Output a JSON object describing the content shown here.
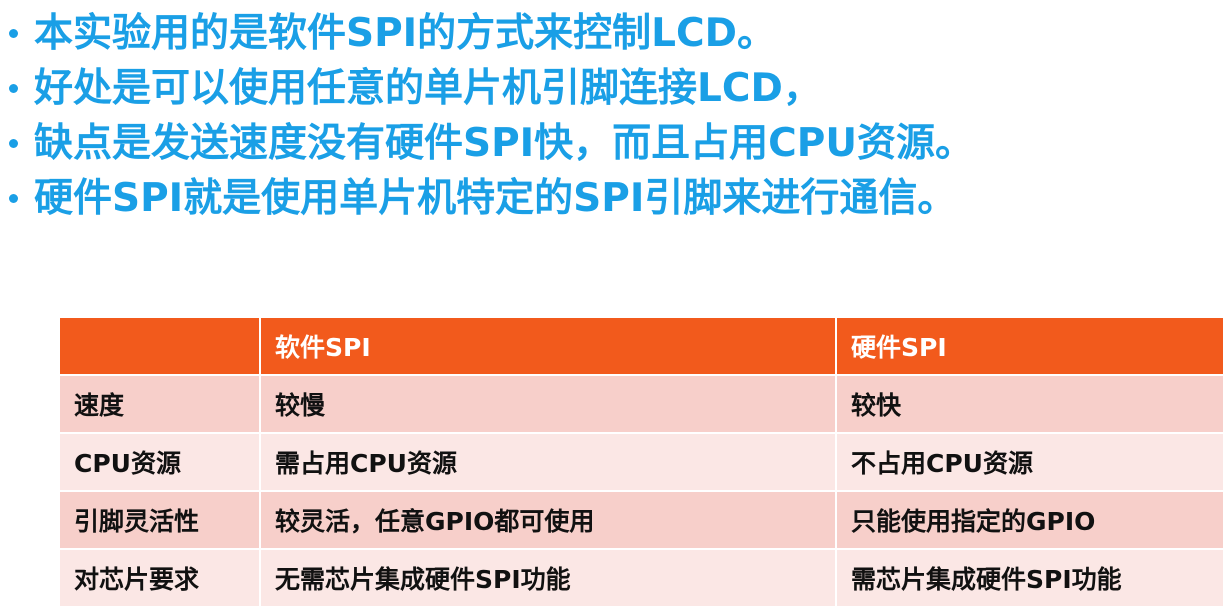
{
  "colors": {
    "bullet_text": "#1a9fe6",
    "header_bg": "#f25a1c",
    "row_dark": "#f7cfca",
    "row_light": "#fbe7e5",
    "cell_text": "#111111",
    "header_text": "#ffffff"
  },
  "bullets": [
    "本实验用的是软件SPI的方式来控制LCD。",
    "好处是可以使用任意的单片机引脚连接LCD，",
    "缺点是发送速度没有硬件SPI快，而且占用CPU资源。",
    "硬件SPI就是使用单片机特定的SPI引脚来进行通信。"
  ],
  "table": {
    "headers": [
      "",
      "软件SPI",
      "硬件SPI"
    ],
    "rows": [
      [
        "速度",
        "较慢",
        "较快"
      ],
      [
        "CPU资源",
        "需占用CPU资源",
        "不占用CPU资源"
      ],
      [
        "引脚灵活性",
        "较灵活，任意GPIO都可使用",
        "只能使用指定的GPIO"
      ],
      [
        "对芯片要求",
        "无需芯片集成硬件SPI功能",
        "需芯片集成硬件SPI功能"
      ]
    ]
  }
}
